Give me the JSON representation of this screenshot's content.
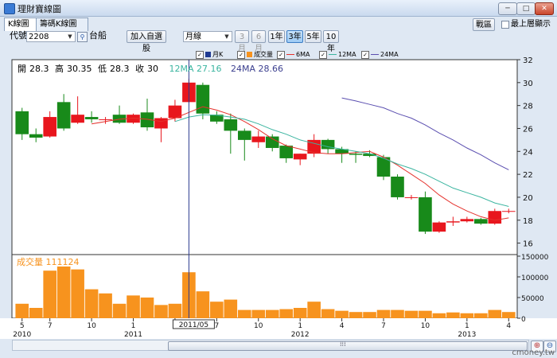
{
  "window": {
    "title": "理財寶線圖",
    "close_label": "✕",
    "min_label": "─",
    "max_label": "□"
  },
  "tabs": [
    {
      "label": "K線圖"
    },
    {
      "label": "籌碼K線圖"
    }
  ],
  "controls": {
    "code_label": "代號",
    "code_value": "2208",
    "stock_name": "台船",
    "add_button": "加入自選股",
    "period_value": "月線",
    "ranges": [
      "3月",
      "6月",
      "1年",
      "3年",
      "5年",
      "10年"
    ],
    "active_range": "3年",
    "right_button": "戰區",
    "topmost_label": "最上層顯示"
  },
  "legend": [
    {
      "label": "月K",
      "color": "#1f3a93",
      "checked": true
    },
    {
      "label": "成交量",
      "color": "#f7931e",
      "checked": true
    },
    {
      "label": "6MA",
      "color": "#e5322d",
      "checked": true
    },
    {
      "label": "12MA",
      "color": "#3bb5a0",
      "checked": true
    },
    {
      "label": "24MA",
      "color": "#5b4fb0",
      "checked": true
    }
  ],
  "info": {
    "open_label": "開",
    "open": "28.3",
    "high_label": "高",
    "high": "30.35",
    "low_label": "低",
    "low": "28.3",
    "close_label": "收",
    "close": "30",
    "ma12": "12MA 27.16",
    "ma24": "24MA 28.66",
    "volume": "成交量 111124"
  },
  "colors": {
    "up": "#e8161d",
    "down": "#188a1a",
    "volume": "#f7931e",
    "ma6": "#e5322d",
    "ma12": "#3bb5a0",
    "ma24": "#5b4fb0",
    "cursor": "#2b3a8f"
  },
  "cursor_label": "2011/05",
  "watermark": "cmoney.tw",
  "chart_data": {
    "type": "candlestick",
    "price_axis": {
      "ticks": [
        16,
        18,
        20,
        22,
        24,
        26,
        28,
        30,
        32
      ],
      "ylim": [
        15,
        32
      ]
    },
    "volume_axis": {
      "ticks": [
        0,
        50000,
        100000,
        150000
      ],
      "ylim": [
        0,
        150000
      ]
    },
    "x_ticks": [
      {
        "label": "5",
        "index": 0
      },
      {
        "label": "7",
        "index": 2
      },
      {
        "label": "10",
        "index": 5
      },
      {
        "label": "1",
        "index": 8
      },
      {
        "label": "4",
        "index": 11
      },
      {
        "label": "7",
        "index": 14
      },
      {
        "label": "10",
        "index": 17
      },
      {
        "label": "1",
        "index": 20
      },
      {
        "label": "4",
        "index": 23
      },
      {
        "label": "7",
        "index": 26
      },
      {
        "label": "10",
        "index": 29
      },
      {
        "label": "1",
        "index": 32
      },
      {
        "label": "4",
        "index": 35
      }
    ],
    "year_ticks": [
      {
        "label": "2010",
        "index": 0
      },
      {
        "label": "2011",
        "index": 8
      },
      {
        "label": "2012",
        "index": 20
      },
      {
        "label": "2013",
        "index": 32
      }
    ],
    "cursor_index": 12,
    "candles": [
      {
        "o": 27.5,
        "h": 27.8,
        "l": 25.0,
        "c": 25.5,
        "v": 35000
      },
      {
        "o": 25.5,
        "h": 26.0,
        "l": 24.8,
        "c": 25.2,
        "v": 25000
      },
      {
        "o": 25.3,
        "h": 27.5,
        "l": 25.2,
        "c": 27.0,
        "v": 115000
      },
      {
        "o": 28.3,
        "h": 29.0,
        "l": 25.8,
        "c": 26.0,
        "v": 125000
      },
      {
        "o": 26.5,
        "h": 28.8,
        "l": 26.4,
        "c": 27.2,
        "v": 118000
      },
      {
        "o": 27.0,
        "h": 27.5,
        "l": 26.5,
        "c": 26.8,
        "v": 70000
      },
      {
        "o": 26.8,
        "h": 27.0,
        "l": 26.4,
        "c": 26.8,
        "v": 60000
      },
      {
        "o": 27.2,
        "h": 28.0,
        "l": 26.4,
        "c": 26.5,
        "v": 35000
      },
      {
        "o": 26.5,
        "h": 27.3,
        "l": 26.4,
        "c": 27.2,
        "v": 55000
      },
      {
        "o": 27.4,
        "h": 28.6,
        "l": 25.8,
        "c": 26.1,
        "v": 50000
      },
      {
        "o": 26.0,
        "h": 27.0,
        "l": 24.8,
        "c": 26.9,
        "v": 32000
      },
      {
        "o": 26.9,
        "h": 28.5,
        "l": 26.6,
        "c": 28.0,
        "v": 35000
      },
      {
        "o": 28.3,
        "h": 30.35,
        "l": 28.3,
        "c": 30.0,
        "v": 111124
      },
      {
        "o": 29.8,
        "h": 30.0,
        "l": 26.8,
        "c": 27.3,
        "v": 65000
      },
      {
        "o": 27.2,
        "h": 27.5,
        "l": 26.4,
        "c": 26.6,
        "v": 40000
      },
      {
        "o": 26.8,
        "h": 27.3,
        "l": 23.8,
        "c": 25.8,
        "v": 45000
      },
      {
        "o": 25.8,
        "h": 26.0,
        "l": 23.2,
        "c": 25.0,
        "v": 20000
      },
      {
        "o": 24.8,
        "h": 25.8,
        "l": 24.3,
        "c": 25.3,
        "v": 20000
      },
      {
        "o": 25.3,
        "h": 25.5,
        "l": 24.0,
        "c": 24.3,
        "v": 20000
      },
      {
        "o": 24.5,
        "h": 24.6,
        "l": 23.0,
        "c": 23.4,
        "v": 22000
      },
      {
        "o": 23.3,
        "h": 23.8,
        "l": 22.8,
        "c": 23.8,
        "v": 25000
      },
      {
        "o": 23.8,
        "h": 25.5,
        "l": 23.5,
        "c": 25.0,
        "v": 40000
      },
      {
        "o": 25.0,
        "h": 25.1,
        "l": 23.8,
        "c": 24.2,
        "v": 22000
      },
      {
        "o": 24.2,
        "h": 24.4,
        "l": 23.0,
        "c": 23.8,
        "v": 18000
      },
      {
        "o": 23.8,
        "h": 24.0,
        "l": 23.0,
        "c": 23.7,
        "v": 15000
      },
      {
        "o": 23.8,
        "h": 24.1,
        "l": 23.5,
        "c": 23.6,
        "v": 15000
      },
      {
        "o": 23.5,
        "h": 23.7,
        "l": 21.5,
        "c": 21.8,
        "v": 20000
      },
      {
        "o": 21.8,
        "h": 22.0,
        "l": 19.8,
        "c": 20.0,
        "v": 20000
      },
      {
        "o": 20.0,
        "h": 20.2,
        "l": 19.8,
        "c": 20.0,
        "v": 18000
      },
      {
        "o": 20.0,
        "h": 20.5,
        "l": 16.8,
        "c": 17.0,
        "v": 18000
      },
      {
        "o": 17.0,
        "h": 17.9,
        "l": 16.9,
        "c": 17.8,
        "v": 12000
      },
      {
        "o": 17.8,
        "h": 18.3,
        "l": 17.5,
        "c": 17.9,
        "v": 14000
      },
      {
        "o": 17.9,
        "h": 18.3,
        "l": 17.8,
        "c": 18.1,
        "v": 12000
      },
      {
        "o": 18.1,
        "h": 18.2,
        "l": 17.6,
        "c": 17.7,
        "v": 12000
      },
      {
        "o": 17.7,
        "h": 19.0,
        "l": 17.6,
        "c": 18.8,
        "v": 20000
      },
      {
        "o": 18.8,
        "h": 19.0,
        "l": 18.6,
        "c": 18.8,
        "v": 15000
      }
    ],
    "ma6": [
      null,
      null,
      null,
      null,
      null,
      26.4,
      26.6,
      26.8,
      26.9,
      26.8,
      26.6,
      26.9,
      27.4,
      27.9,
      27.6,
      27.2,
      26.6,
      25.9,
      25.1,
      24.5,
      24.2,
      23.9,
      23.8,
      23.8,
      23.9,
      24.0,
      23.5,
      22.8,
      22.0,
      21.2,
      20.2,
      19.4,
      18.8,
      18.3,
      18.0,
      18.2
    ],
    "ma12": [
      null,
      null,
      null,
      null,
      null,
      null,
      null,
      null,
      null,
      null,
      null,
      26.6,
      27.0,
      27.2,
      27.16,
      27.0,
      26.8,
      26.4,
      25.9,
      25.5,
      25.0,
      24.7,
      24.4,
      24.2,
      24.0,
      23.8,
      23.4,
      22.9,
      22.5,
      22.0,
      21.4,
      20.8,
      20.4,
      20.0,
      19.5,
      19.2
    ],
    "ma24": [
      null,
      null,
      null,
      null,
      null,
      null,
      null,
      null,
      null,
      null,
      null,
      null,
      null,
      null,
      null,
      null,
      null,
      null,
      null,
      null,
      null,
      null,
      null,
      28.66,
      28.4,
      28.1,
      27.8,
      27.3,
      26.9,
      26.3,
      25.6,
      25.0,
      24.3,
      23.7,
      23.0,
      22.4
    ]
  }
}
